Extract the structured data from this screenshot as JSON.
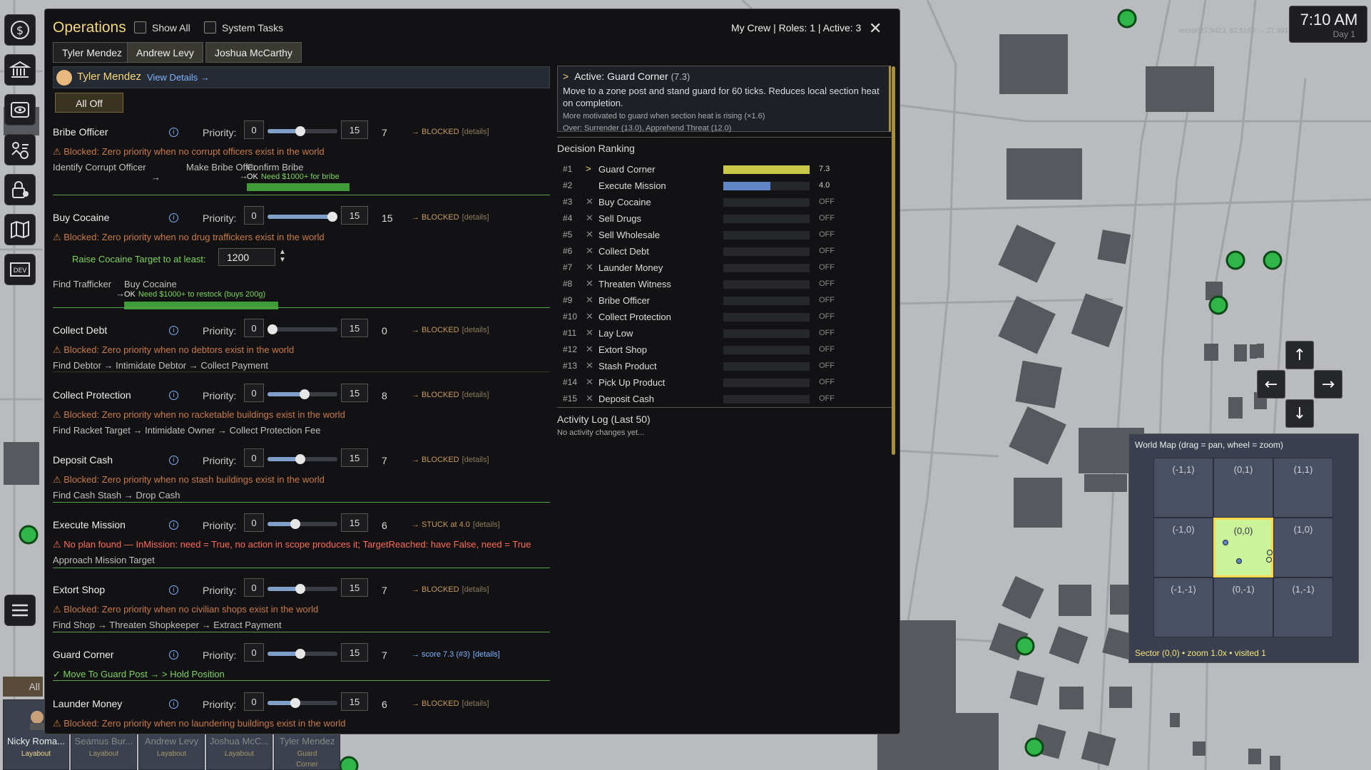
{
  "clock": {
    "time": "7:10 AM",
    "day": "Day 1",
    "sector_coords": "sector[27.9423, 82.5169 → 27.9915,-82.4356]"
  },
  "sidebar": {
    "items": [
      {
        "icon": "dollar-icon"
      },
      {
        "icon": "bank-icon"
      },
      {
        "icon": "eye-icon"
      },
      {
        "icon": "operations-icon"
      },
      {
        "icon": "lock-user-icon"
      },
      {
        "icon": "map-icon"
      },
      {
        "icon": "dev-icon",
        "label": "DEV"
      },
      {
        "icon": "menu-icon"
      }
    ]
  },
  "operations": {
    "title": "Operations",
    "show_all_label": "Show All",
    "system_tasks_label": "System Tasks",
    "crew_info": "My Crew | Roles: 1 | Active: 3",
    "close_glyph": "✕",
    "tabs": [
      "Tyler Mendez",
      "Andrew Levy",
      "Joshua McCarthy"
    ],
    "character": {
      "name": "Tyler Mendez",
      "view_details": "View Details →"
    },
    "all_off_label": "All Off",
    "priority_label": "Priority:",
    "priority_min": "0",
    "priority_max": "15",
    "info_glyph": "i",
    "goals": [
      {
        "name": "Bribe Officer",
        "priority": 7,
        "status": "→ BLOCKED",
        "details": "[details]",
        "warning": "⚠ Blocked: Zero priority when no corrupt officers exist in the world",
        "steps_a": "Identify Corrupt Officer",
        "steps_b": "Make Bribe Offer",
        "steps_c": "Confirm Bribe",
        "arrow": "→",
        "ok": "OK",
        "ok_note": "Need $1000+ for bribe"
      },
      {
        "name": "Buy Cocaine",
        "priority": 15,
        "status": "→ BLOCKED",
        "details": "[details]",
        "warning": "⚠ Blocked: Zero priority when no drug traffickers exist in the world",
        "raise_label": "Raise Cocaine Target to at least:",
        "raise_value": "1200",
        "steps_a": "Find Trafficker",
        "steps_b": "Buy Cocaine",
        "arrow": "→",
        "ok": "OK",
        "ok_note": "Need $1000+ to restock (buys 200g)"
      },
      {
        "name": "Collect Debt",
        "priority": 0,
        "status": "→ BLOCKED",
        "details": "[details]",
        "warning": "⚠ Blocked: Zero priority when no debtors exist in the world",
        "steps": "Find Debtor → Intimidate Debtor → Collect Payment"
      },
      {
        "name": "Collect Protection",
        "priority": 8,
        "status": "→ BLOCKED",
        "details": "[details]",
        "warning": "⚠ Blocked: Zero priority when no racketable buildings exist in the world",
        "steps": "Find Racket Target → Intimidate Owner → Collect Protection Fee"
      },
      {
        "name": "Deposit Cash",
        "priority": 7,
        "status": "→ BLOCKED",
        "details": "[details]",
        "warning": "⚠ Blocked: Zero priority when no stash buildings exist in the world",
        "steps": "Find Cash Stash → Drop Cash"
      },
      {
        "name": "Execute Mission",
        "priority": 6,
        "status": "→ STUCK at 4.0",
        "details": "[details]",
        "warning": "⚠ No plan found — InMission: need = True, no action in scope produces it; TargetReached: have False, need = True",
        "steps": "Approach Mission Target"
      },
      {
        "name": "Extort Shop",
        "priority": 7,
        "status": "→ BLOCKED",
        "details": "[details]",
        "warning": "⚠ Blocked: Zero priority when no civilian shops exist in the world",
        "steps": "Find Shop → Threaten Shopkeeper → Extract Payment"
      },
      {
        "name": "Guard Corner",
        "priority": 7,
        "status": "→ score 7.3  (#3)",
        "details": "[details]",
        "steps": "✓ Move To Guard Post → > Hold Position"
      },
      {
        "name": "Launder Money",
        "priority": 6,
        "status": "→ BLOCKED",
        "details": "[details]",
        "warning": "⚠ Blocked: Zero priority when no laundering buildings exist in the world"
      }
    ],
    "active": {
      "marker": ">",
      "heading": "Active: Guard Corner",
      "score": "(7.3)",
      "description": "Move to a zone post and stand guard for 60 ticks. Reduces local section heat on completion.",
      "motivation": "More motivated to guard when section heat is rising (×1.6)",
      "over": "Over: Surrender (13.0), Apprehend Threat (12.0)"
    },
    "ranking_title": "Decision Ranking",
    "ranking": [
      {
        "rank": "#1",
        "mark": ">",
        "label": "Guard Corner",
        "value": "7.3",
        "score": 7.3,
        "color": "#c9c84a"
      },
      {
        "rank": "#2",
        "mark": "",
        "label": "Execute Mission",
        "value": "4.0",
        "score": 4.0,
        "color": "#5f86c5"
      },
      {
        "rank": "#3",
        "mark": "✕",
        "label": "Buy Cocaine",
        "value": "OFF",
        "score": 0
      },
      {
        "rank": "#4",
        "mark": "✕",
        "label": "Sell Drugs",
        "value": "OFF",
        "score": 0
      },
      {
        "rank": "#5",
        "mark": "✕",
        "label": "Sell Wholesale",
        "value": "OFF",
        "score": 0
      },
      {
        "rank": "#6",
        "mark": "✕",
        "label": "Collect Debt",
        "value": "OFF",
        "score": 0
      },
      {
        "rank": "#7",
        "mark": "✕",
        "label": "Launder Money",
        "value": "OFF",
        "score": 0
      },
      {
        "rank": "#8",
        "mark": "✕",
        "label": "Threaten Witness",
        "value": "OFF",
        "score": 0
      },
      {
        "rank": "#9",
        "mark": "✕",
        "label": "Bribe Officer",
        "value": "OFF",
        "score": 0
      },
      {
        "rank": "#10",
        "mark": "✕",
        "label": "Collect Protection",
        "value": "OFF",
        "score": 0
      },
      {
        "rank": "#11",
        "mark": "✕",
        "label": "Lay Low",
        "value": "OFF",
        "score": 0
      },
      {
        "rank": "#12",
        "mark": "✕",
        "label": "Extort Shop",
        "value": "OFF",
        "score": 0
      },
      {
        "rank": "#13",
        "mark": "✕",
        "label": "Stash Product",
        "value": "OFF",
        "score": 0
      },
      {
        "rank": "#14",
        "mark": "✕",
        "label": "Pick Up Product",
        "value": "OFF",
        "score": 0
      },
      {
        "rank": "#15",
        "mark": "✕",
        "label": "Deposit Cash",
        "value": "OFF",
        "score": 0
      }
    ],
    "log_title": "Activity Log (Last 50)",
    "log_empty": "No activity changes yet..."
  },
  "arrows": {
    "up": "↑",
    "left": "←",
    "right": "→",
    "down": "↓"
  },
  "worldmap": {
    "title": "World Map (drag = pan, wheel = zoom)",
    "cells": [
      "(-1,1)",
      "(0,1)",
      "(1,1)",
      "(-1,0)",
      "(0,0)",
      "(1,0)",
      "(-1,-1)",
      "(0,-1)",
      "(1,-1)"
    ],
    "status": "Sector (0,0)  •  zoom 1.0x  •  visited 1"
  },
  "crew_bar": {
    "all_label": "All",
    "members": [
      {
        "name": "Nicky Roma...",
        "role": "Layabout"
      },
      {
        "name": "Seamus Bur...",
        "role": "Layabout"
      },
      {
        "name": "Andrew Levy",
        "role": "Layabout"
      },
      {
        "name": "Joshua McC...",
        "role": "Layabout"
      },
      {
        "name": "Tyler Mendez",
        "role": "Guard Corner"
      }
    ]
  }
}
